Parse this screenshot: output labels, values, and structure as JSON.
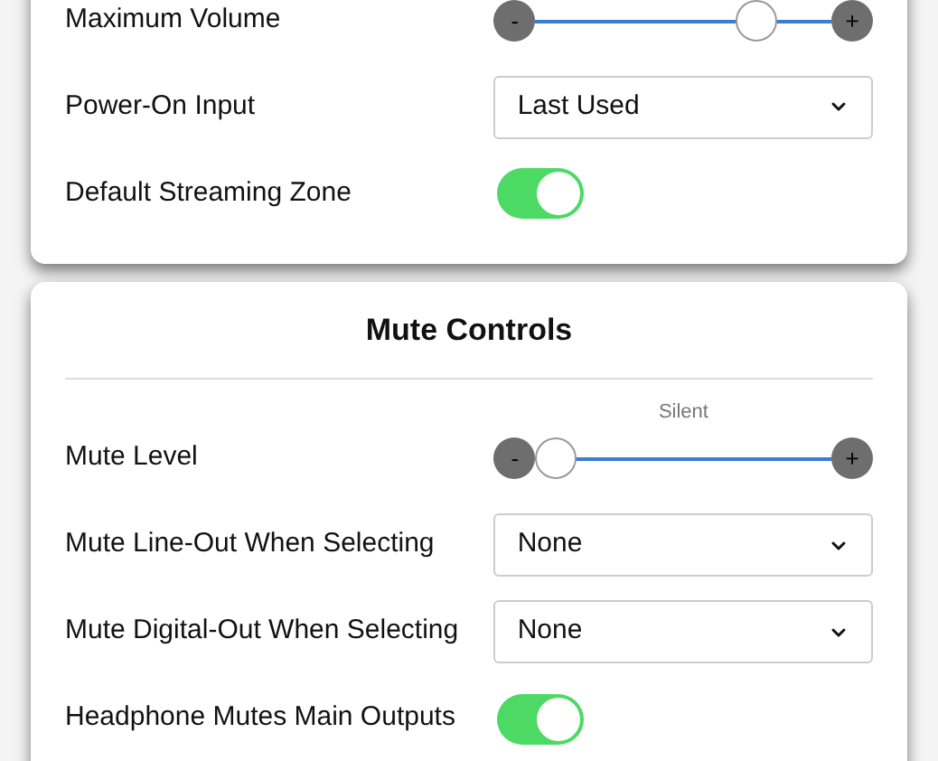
{
  "sections": [
    {
      "rows": [
        {
          "kind": "slider",
          "label": "Maximum Volume",
          "minus": "-",
          "plus": "+",
          "level": 0.79
        },
        {
          "kind": "select",
          "label": "Power-On Input",
          "value": "Last Used"
        },
        {
          "kind": "toggle",
          "label": "Default Streaming Zone",
          "on": true
        }
      ]
    },
    {
      "title": "Mute Controls",
      "rows": [
        {
          "kind": "slider",
          "label": "Mute Level",
          "minus": "-",
          "plus": "+",
          "level": 0,
          "reading": "Silent"
        },
        {
          "kind": "select",
          "label": "Mute Line-Out When Selecting",
          "value": "None"
        },
        {
          "kind": "select",
          "label": "Mute Digital-Out When Selecting",
          "value": "None"
        },
        {
          "kind": "toggle",
          "label": "Headphone Mutes Main Outputs",
          "on": true
        }
      ]
    }
  ]
}
